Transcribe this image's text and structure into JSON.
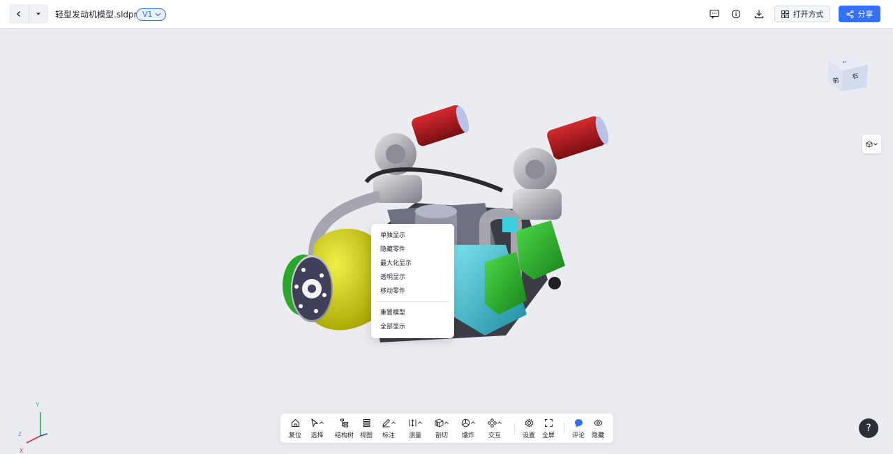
{
  "header": {
    "filename": "轻型发动机模型.sldprt",
    "version": "V1",
    "open_with_label": "打开方式",
    "share_label": "分享"
  },
  "viewcube": {
    "front": "前",
    "right": "右"
  },
  "context_menu": {
    "items": [
      "单独显示",
      "隐藏零件",
      "最大化显示",
      "透明显示",
      "移动零件"
    ],
    "items2": [
      "重置模型",
      "全部显示"
    ]
  },
  "toolbar": {
    "reset": "复位",
    "select": "选择",
    "structure_tree": "结构树",
    "view": "视图",
    "annotate": "标注",
    "measure": "测量",
    "section": "剖切",
    "explode": "爆炸",
    "interact": "交互",
    "settings": "设置",
    "fullscreen": "全屏",
    "comment": "评论",
    "hide": "隐藏"
  },
  "axes": {
    "y": "Y",
    "z": "Z",
    "x": "X"
  },
  "help_label": "?",
  "colors": {
    "accent": "#3370ff",
    "background": "#ebecf1",
    "toolbar": "#ffffff"
  }
}
